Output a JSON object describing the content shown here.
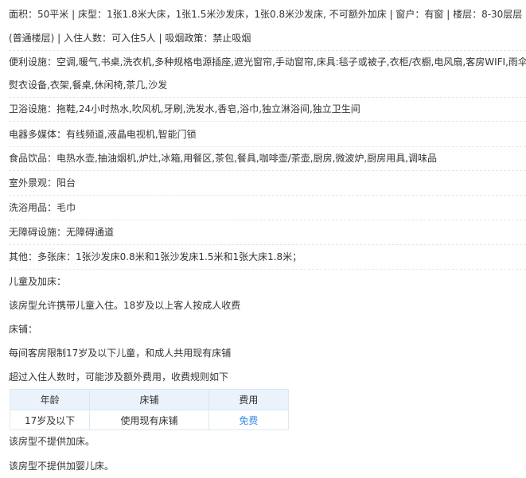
{
  "room": {
    "line1": "面积：50平米 | 床型：1张1.8米大床，1张1.5米沙发床，1张0.8米沙发床, 不可额外加床 | 窗户：有窗 | 楼层：8-30层层",
    "line2": "(普通楼层) | 入住人数：可入住5人 | 吸烟政策：禁止吸烟"
  },
  "facilities": [
    {
      "label": "便利设施：",
      "text": "空调,暖气,书桌,洗衣机,多种规格电源插座,遮光窗帘,手动窗帘,床具:毯子或被子,衣柜/衣橱,电风扇,客房WIFI,雨伞,"
    },
    {
      "label": "",
      "text": "熨衣设备,衣架,餐桌,休闲椅,茶几,沙发"
    },
    {
      "label": "卫浴设施：",
      "text": "拖鞋,24小时热水,吹风机,牙刷,洗发水,香皂,浴巾,独立淋浴间,独立卫生间"
    },
    {
      "label": "电器多媒体：",
      "text": "有线频道,液晶电视机,智能门锁"
    },
    {
      "label": "食品饮品：",
      "text": "电热水壶,抽油烟机,炉灶,冰箱,用餐区,茶包,餐具,咖啡壶/茶壶,厨房,微波炉,厨房用具,调味品"
    },
    {
      "label": "室外景观：",
      "text": "阳台"
    },
    {
      "label": "洗浴用品：",
      "text": "毛巾"
    },
    {
      "label": "无障碍设施：",
      "text": "无障碍通道"
    },
    {
      "label": "其他：",
      "text": "多张床：1张沙发床0.8米和1张沙发床1.5米和1张大床1.8米；"
    }
  ],
  "policy": {
    "children_heading": "儿童及加床：",
    "children_allowed": "该房型允许携带儿童入住。18岁及以上客人按成人收费",
    "bed_heading": "床铺：",
    "bed_limit": "每间客房限制17岁及以下儿童，和成人共用现有床铺",
    "extra_fee_note": "超过入住人数时，可能涉及额外费用，收费规则如下",
    "no_extra_bed": "该房型不提供加床。",
    "no_crib": "该房型不提供加婴儿床。"
  },
  "fee_table": {
    "headers": [
      "年龄",
      "床铺",
      "费用"
    ],
    "rows": [
      {
        "age": "17岁及以下",
        "bed": "使用现有床铺",
        "fee": "免费"
      }
    ]
  },
  "colors": {
    "text": "#333333",
    "link": "#3a8ae6",
    "table_header_bg": "#eaf2fb",
    "table_border": "#dbe7f2"
  }
}
